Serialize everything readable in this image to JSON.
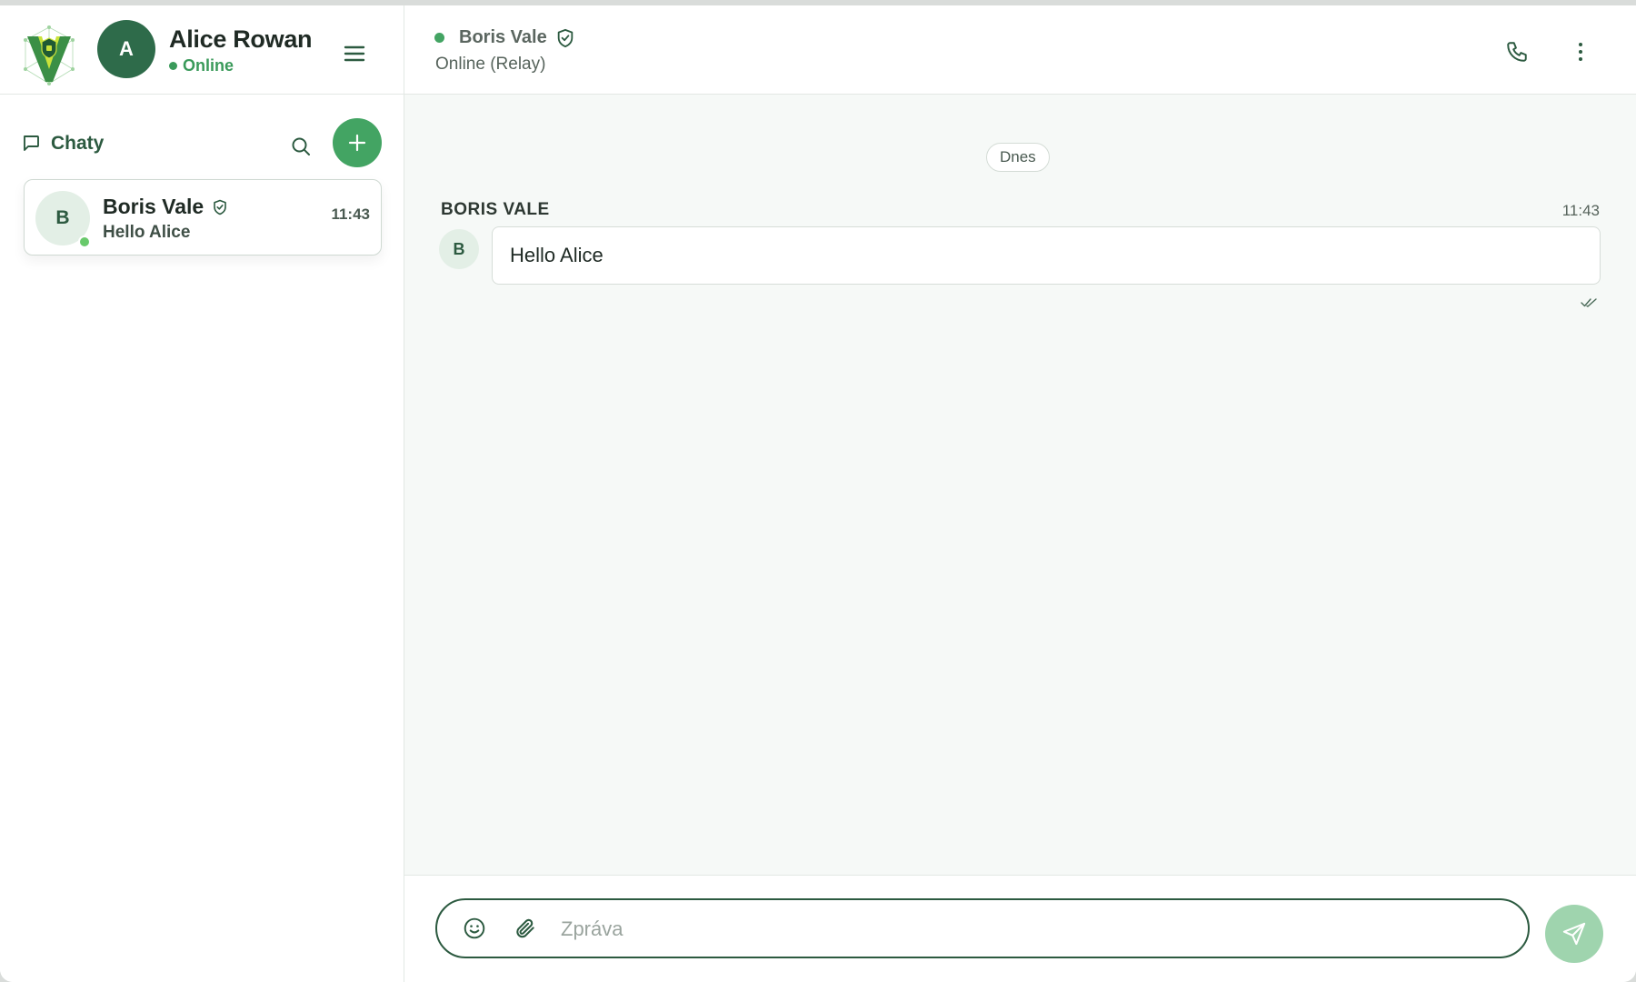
{
  "colors": {
    "accent": "#43a463",
    "dark_green": "#2c5a40",
    "avatar_dark": "#2e6b4a",
    "online": "#3a9a5a",
    "send_disabled": "#9fd4ae"
  },
  "user": {
    "avatar_letter": "A",
    "name": "Alice Rowan",
    "status": "Online"
  },
  "sidebar": {
    "title": "Chaty",
    "icons": [
      "chat-bubble-icon",
      "search-icon",
      "plus-icon",
      "menu-icon"
    ],
    "chats": [
      {
        "avatar_letter": "B",
        "name": "Boris Vale",
        "verified": true,
        "preview": "Hello Alice",
        "time": "11:43",
        "online": true
      }
    ]
  },
  "conversation": {
    "peer_name": "Boris Vale",
    "peer_status": "Online (Relay)",
    "date_divider": "Dnes",
    "messages": [
      {
        "sender": "BORIS VALE",
        "avatar_letter": "B",
        "time": "11:43",
        "text": "Hello Alice",
        "read": true
      }
    ]
  },
  "composer": {
    "placeholder": "Zpráva",
    "value": ""
  }
}
